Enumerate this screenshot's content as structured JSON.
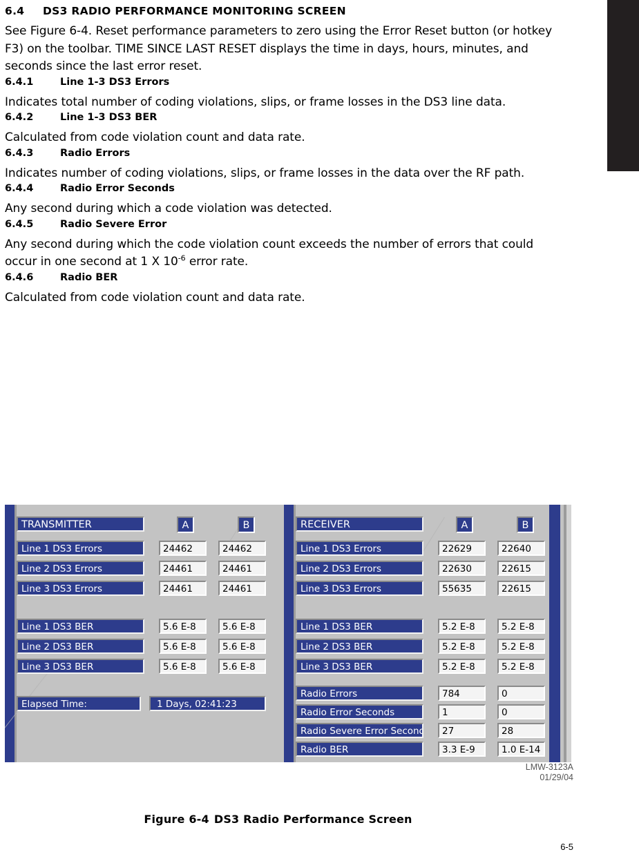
{
  "document": {
    "section": {
      "number": "6.4",
      "title": "DS3 RADIO PERFORMANCE MONITORING SCREEN",
      "body": "See Figure 6-4. Reset performance parameters to zero using the Error Reset button (or hotkey F3) on the toolbar. TIME SINCE LAST RESET displays the time in days, hours, minutes, and seconds since the last error reset."
    },
    "subsections": [
      {
        "number": "6.4.1",
        "title": "Line 1-3 DS3 Errors",
        "body": "Indicates total number of coding violations, slips, or frame losses in the DS3 line data."
      },
      {
        "number": "6.4.2",
        "title": "Line 1-3 DS3 BER",
        "body": "Calculated from code violation count and data rate."
      },
      {
        "number": "6.4.3",
        "title": "Radio Errors",
        "body": "Indicates number of coding violations, slips, or frame losses in the data over the RF path."
      },
      {
        "number": "6.4.4",
        "title": "Radio Error Seconds",
        "body": "Any second during which a code violation was detected."
      },
      {
        "number": "6.4.5",
        "title": "Radio Severe Error",
        "body_part1": "Any second during which the code violation count exceeds the number of errors that could occur in one second at 1 X 10",
        "body_exponent": "-6",
        "body_part2": " error rate."
      },
      {
        "number": "6.4.6",
        "title": "Radio BER",
        "body": "Calculated from code violation count and data rate."
      }
    ],
    "figure": {
      "code": "LMW-3123A",
      "date": "01/29/04",
      "caption_label": "Figure 6-4",
      "caption_title": "DS3 Radio Performance Screen"
    },
    "page_number": "6-5"
  },
  "screen": {
    "column_headers": [
      "A",
      "B"
    ],
    "transmitter": {
      "title": "TRANSMITTER",
      "error_rows": [
        {
          "label": "Line 1 DS3 Errors",
          "a": "24462",
          "b": "24462"
        },
        {
          "label": "Line 2 DS3 Errors",
          "a": "24461",
          "b": "24461"
        },
        {
          "label": "Line 3 DS3 Errors",
          "a": "24461",
          "b": "24461"
        }
      ],
      "ber_rows": [
        {
          "label": "Line 1 DS3 BER",
          "a": "5.6 E-8",
          "b": "5.6 E-8"
        },
        {
          "label": "Line 2 DS3 BER",
          "a": "5.6 E-8",
          "b": "5.6 E-8"
        },
        {
          "label": "Line 3 DS3 BER",
          "a": "5.6 E-8",
          "b": "5.6 E-8"
        }
      ],
      "elapsed": {
        "label": "Elapsed Time:",
        "value": "1 Days, 02:41:23"
      }
    },
    "receiver": {
      "title": "RECEIVER",
      "error_rows": [
        {
          "label": "Line 1 DS3 Errors",
          "a": "22629",
          "b": "22640"
        },
        {
          "label": "Line 2 DS3 Errors",
          "a": "22630",
          "b": "22615"
        },
        {
          "label": "Line 3 DS3 Errors",
          "a": "55635",
          "b": "22615"
        }
      ],
      "ber_rows": [
        {
          "label": "Line 1 DS3 BER",
          "a": "5.2 E-8",
          "b": "5.2 E-8"
        },
        {
          "label": "Line 2 DS3 BER",
          "a": "5.2 E-8",
          "b": "5.2 E-8"
        },
        {
          "label": "Line 3 DS3 BER",
          "a": "5.2 E-8",
          "b": "5.2 E-8"
        }
      ],
      "radio_rows": [
        {
          "label": "Radio Errors",
          "a": "784",
          "b": "0"
        },
        {
          "label": "Radio Error Seconds",
          "a": "1",
          "b": "0"
        },
        {
          "label": "Radio Severe Error Seconds",
          "a": "27",
          "b": "28"
        },
        {
          "label": "Radio BER",
          "a": "3.3 E-9",
          "b": "1.0 E-14"
        }
      ]
    }
  },
  "colors": {
    "label_blue": "#2d3c8c",
    "panel_grey": "#c3c3c3",
    "field_white": "#f4f4f4",
    "tab_black": "#231f20"
  }
}
